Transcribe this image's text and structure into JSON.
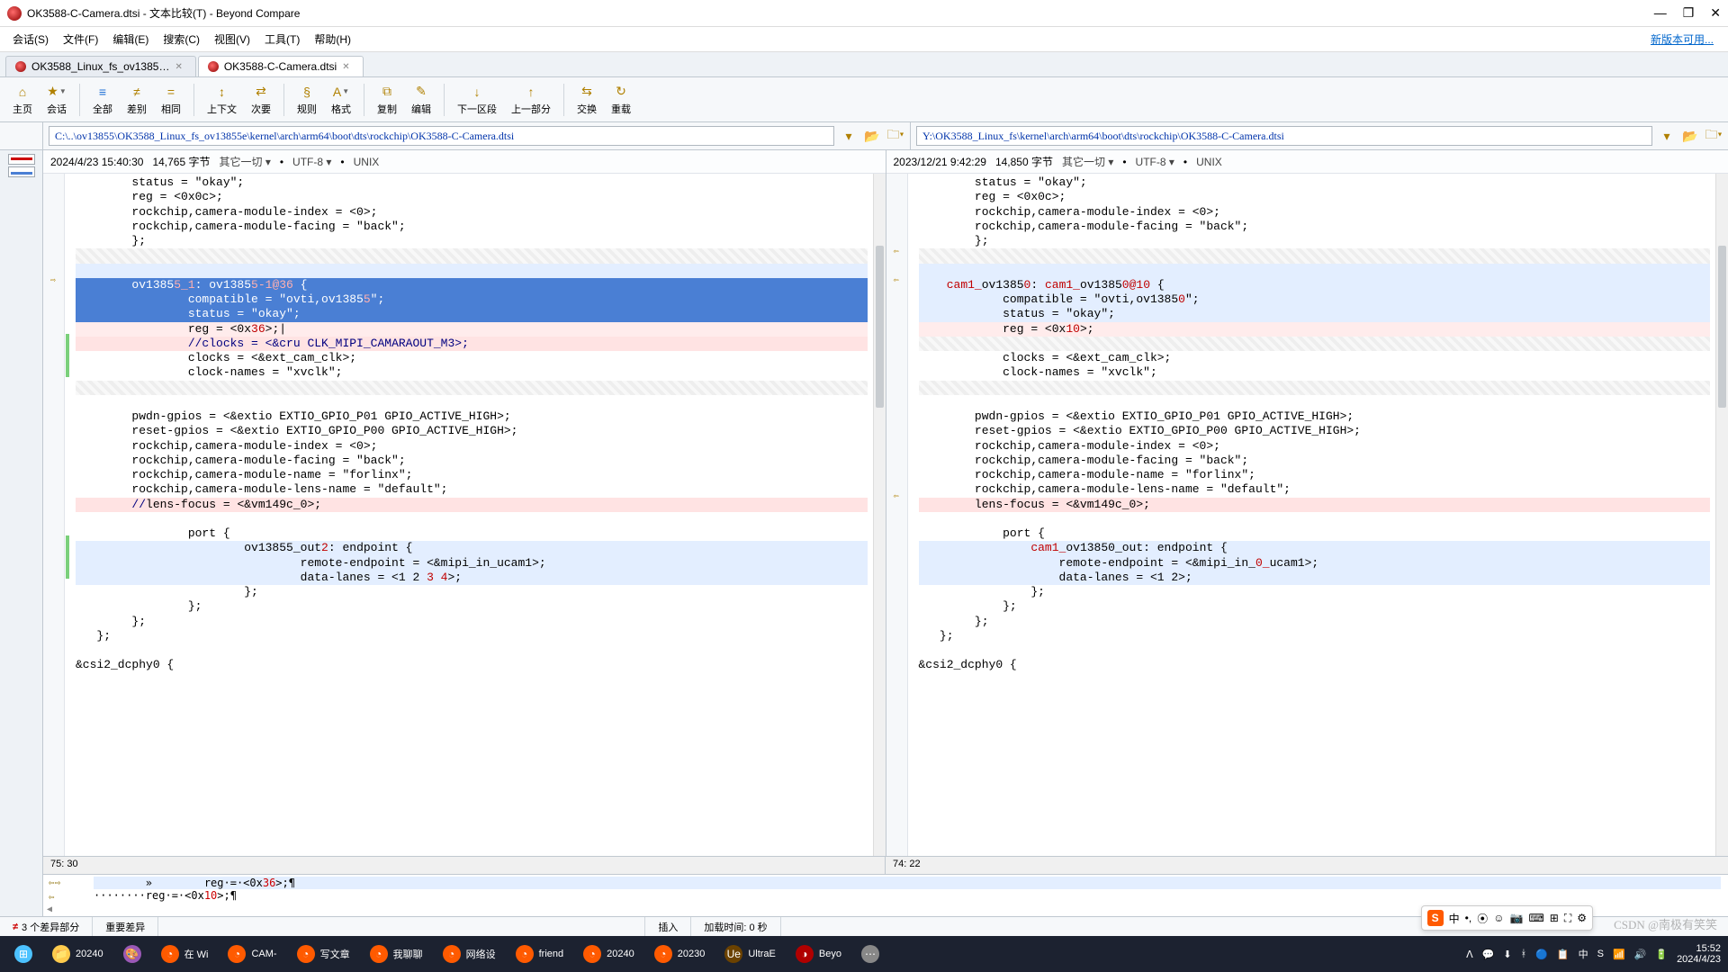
{
  "window": {
    "title": "OK3588-C-Camera.dtsi - 文本比较(T) - Beyond Compare",
    "min": "—",
    "max": "❐",
    "close": "✕",
    "update_link": "新版本可用..."
  },
  "menu": {
    "items": [
      "会话(S)",
      "文件(F)",
      "编辑(E)",
      "搜索(C)",
      "视图(V)",
      "工具(T)",
      "帮助(H)"
    ]
  },
  "filetabs": [
    {
      "label": "OK3588_Linux_fs_ov1385…"
    },
    {
      "label": "OK3588-C-Camera.dtsi"
    }
  ],
  "toolbar": [
    {
      "icon": "⌂",
      "label": "主页"
    },
    {
      "icon": "★",
      "label": "会话",
      "drop": true,
      "sep": true
    },
    {
      "icon": "≡",
      "label": "全部",
      "blue": true
    },
    {
      "icon": "≠",
      "label": "差别"
    },
    {
      "icon": "=",
      "label": "相同",
      "sep": true
    },
    {
      "icon": "↕",
      "label": "上下文"
    },
    {
      "icon": "⇄",
      "label": "次要",
      "sep": true
    },
    {
      "icon": "§",
      "label": "规则"
    },
    {
      "icon": "A",
      "label": "格式",
      "drop": true,
      "sep": true
    },
    {
      "icon": "⧉",
      "label": "复制"
    },
    {
      "icon": "✎",
      "label": "编辑",
      "sep": true
    },
    {
      "icon": "↓",
      "label": "下一区段"
    },
    {
      "icon": "↑",
      "label": "上一部分",
      "sep": true
    },
    {
      "icon": "⇆",
      "label": "交换"
    },
    {
      "icon": "↻",
      "label": "重载"
    }
  ],
  "paths": {
    "left": "C:\\..\\ov13855\\OK3588_Linux_fs_ov13855e\\kernel\\arch\\arm64\\boot\\dts\\rockchip\\OK3588-C-Camera.dtsi",
    "right": "Y:\\OK3588_Linux_fs\\kernel\\arch\\arm64\\boot\\dts\\rockchip\\OK3588-C-Camera.dtsi"
  },
  "info": {
    "left": {
      "date": "2024/4/23 15:40:30",
      "size": "14,765 字节",
      "mode": "其它一切 ▾",
      "enc": "UTF-8 ▾",
      "eol": "UNIX"
    },
    "right": {
      "date": "2023/12/21 9:42:29",
      "size": "14,850 字节",
      "mode": "其它一切 ▾",
      "enc": "UTF-8 ▾",
      "eol": "UNIX"
    }
  },
  "cursor": {
    "left": "75: 30",
    "right": "74: 22"
  },
  "diffbar": {
    "a_prefix": "        »        reg·=·<0x",
    "a_val": "36",
    "a_suffix": ">;¶",
    "b_prefix": "········reg·=·<0x",
    "b_val": "10",
    "b_suffix": ">;¶"
  },
  "status": {
    "diffs": "3 个差异部分",
    "mode": "重要差异",
    "ins": "插入",
    "load": "加载时间: 0 秒"
  },
  "left_lines": [
    {
      "cls": "same",
      "t": "        status = \"okay\";"
    },
    {
      "cls": "same",
      "t": "        reg = <0x0c>;"
    },
    {
      "cls": "same",
      "t": "        rockchip,camera-module-index = <0>;"
    },
    {
      "cls": "same",
      "t": "        rockchip,camera-module-facing = \"back\";"
    },
    {
      "cls": "same",
      "t": "        };"
    },
    {
      "cls": "hatch",
      "t": " "
    },
    {
      "cls": "diffblue",
      "t": " "
    },
    {
      "cls": "sel",
      "html": "        ov1385<span class='red' style='color:#ffb0b0'>5_1</span>: ov1385<span style='color:#ffb0b0'>5-1@36</span> {",
      "mark": "⇨"
    },
    {
      "cls": "sel",
      "html": "                compatible = \"ovti,ov1385<span style='color:#ffb0b0'>5</span>\";"
    },
    {
      "cls": "sel",
      "t": "                status = \"okay\";"
    },
    {
      "cls": "diffltred",
      "html": "                reg = &lt;0x<span class='red'>36</span>&gt;;|"
    },
    {
      "cls": "diffred",
      "html": "                <span class='nav'>//clocks = &lt;&amp;cru CLK_MIPI_CAMARAOUT_M3&gt;;</span>",
      "strip": true
    },
    {
      "cls": "same",
      "t": "                clocks = <&ext_cam_clk>;",
      "strip": true
    },
    {
      "cls": "same",
      "t": "                clock-names = \"xvclk\";",
      "strip": true
    },
    {
      "cls": "hatch",
      "t": " "
    },
    {
      "cls": "same",
      "t": " "
    },
    {
      "cls": "same",
      "t": "        pwdn-gpios = <&extio EXTIO_GPIO_P01 GPIO_ACTIVE_HIGH>;"
    },
    {
      "cls": "same",
      "t": "        reset-gpios = <&extio EXTIO_GPIO_P00 GPIO_ACTIVE_HIGH>;"
    },
    {
      "cls": "same",
      "t": "        rockchip,camera-module-index = <0>;"
    },
    {
      "cls": "same",
      "t": "        rockchip,camera-module-facing = \"back\";"
    },
    {
      "cls": "same",
      "t": "        rockchip,camera-module-name = \"forlinx\";"
    },
    {
      "cls": "same",
      "t": "        rockchip,camera-module-lens-name = \"default\";"
    },
    {
      "cls": "diffred",
      "html": "        <span class='nav'>//</span>lens-focus = &lt;&amp;vm149c_0&gt;;"
    },
    {
      "cls": "same",
      "t": " "
    },
    {
      "cls": "same",
      "t": "                port {"
    },
    {
      "cls": "diffblue",
      "html": "                        ov13855_out<span class='red'>2</span>: endpoint {",
      "strip": true
    },
    {
      "cls": "diffblue",
      "html": "                                remote-endpoint = &lt;&amp;mipi_in_ucam1&gt;;",
      "strip": true
    },
    {
      "cls": "diffblue",
      "html": "                                data-lanes = &lt;1 2 <span class='red'>3 4</span>&gt;;",
      "strip": true
    },
    {
      "cls": "same",
      "t": "                        };"
    },
    {
      "cls": "same",
      "t": "                };"
    },
    {
      "cls": "same",
      "t": "        };"
    },
    {
      "cls": "same",
      "t": "   };"
    },
    {
      "cls": "same",
      "t": " "
    },
    {
      "cls": "same",
      "t": "&csi2_dcphy0 {"
    }
  ],
  "right_lines": [
    {
      "cls": "same",
      "t": "        status = \"okay\";"
    },
    {
      "cls": "same",
      "t": "        reg = <0x0c>;"
    },
    {
      "cls": "same",
      "t": "        rockchip,camera-module-index = <0>;"
    },
    {
      "cls": "same",
      "t": "        rockchip,camera-module-facing = \"back\";"
    },
    {
      "cls": "same",
      "t": "        };"
    },
    {
      "cls": "hatch",
      "t": " ",
      "mark": "⇦"
    },
    {
      "cls": "diffblue",
      "t": " "
    },
    {
      "cls": "diffblue",
      "html": "    <span class='red'>cam1_</span>ov1385<span class='red'>0</span>: <span class='red'>cam1_</span>ov1385<span class='red'>0@10</span> {",
      "mark": "⇦"
    },
    {
      "cls": "diffblue",
      "html": "            compatible = \"ovti,ov1385<span class='red'>0</span>\";"
    },
    {
      "cls": "diffblue",
      "t": "            status = \"okay\";"
    },
    {
      "cls": "diffltred",
      "html": "            reg = &lt;0x<span class='red'>10</span>&gt;;"
    },
    {
      "cls": "hatch",
      "t": " "
    },
    {
      "cls": "same",
      "t": "            clocks = <&ext_cam_clk>;"
    },
    {
      "cls": "same",
      "t": "            clock-names = \"xvclk\";"
    },
    {
      "cls": "hatch",
      "t": " "
    },
    {
      "cls": "same",
      "t": " "
    },
    {
      "cls": "same",
      "t": "        pwdn-gpios = <&extio EXTIO_GPIO_P01 GPIO_ACTIVE_HIGH>;"
    },
    {
      "cls": "same",
      "t": "        reset-gpios = <&extio EXTIO_GPIO_P00 GPIO_ACTIVE_HIGH>;"
    },
    {
      "cls": "same",
      "t": "        rockchip,camera-module-index = <0>;"
    },
    {
      "cls": "same",
      "t": "        rockchip,camera-module-facing = \"back\";"
    },
    {
      "cls": "same",
      "t": "        rockchip,camera-module-name = \"forlinx\";"
    },
    {
      "cls": "same",
      "t": "        rockchip,camera-module-lens-name = \"default\";"
    },
    {
      "cls": "diffred",
      "t": "        lens-focus = <&vm149c_0>;",
      "mark": "⇦"
    },
    {
      "cls": "same",
      "t": " "
    },
    {
      "cls": "same",
      "t": "            port {"
    },
    {
      "cls": "diffblue",
      "html": "                <span class='red'>cam1_</span>ov13850_out: endpoint {"
    },
    {
      "cls": "diffblue",
      "html": "                    remote-endpoint = &lt;&amp;mipi_in_<span class='red'>0_</span>ucam1&gt;;"
    },
    {
      "cls": "diffblue",
      "t": "                    data-lanes = <1 2>;"
    },
    {
      "cls": "same",
      "t": "                };"
    },
    {
      "cls": "same",
      "t": "            };"
    },
    {
      "cls": "same",
      "t": "        };"
    },
    {
      "cls": "same",
      "t": "   };"
    },
    {
      "cls": "same",
      "t": " "
    },
    {
      "cls": "same",
      "t": "&csi2_dcphy0 {"
    }
  ],
  "taskbar": {
    "items": [
      {
        "icon": "⊞",
        "color": "#4cc2ff",
        "label": ""
      },
      {
        "icon": "📁",
        "color": "#ffcc4d",
        "label": "20240"
      },
      {
        "icon": "🎨",
        "color": "#9b59b6",
        "label": ""
      },
      {
        "icon": "◔",
        "color": "#ff5a00",
        "label": "在 Wi"
      },
      {
        "icon": "◔",
        "color": "#ff5a00",
        "label": "CAM-"
      },
      {
        "icon": "◔",
        "color": "#ff5a00",
        "label": "写文章"
      },
      {
        "icon": "◔",
        "color": "#ff5a00",
        "label": "我聊聊"
      },
      {
        "icon": "◔",
        "color": "#ff5a00",
        "label": "网络设"
      },
      {
        "icon": "◔",
        "color": "#ff5a00",
        "label": "friend"
      },
      {
        "icon": "◔",
        "color": "#ff5a00",
        "label": "20240"
      },
      {
        "icon": "◔",
        "color": "#ff5a00",
        "label": "20230"
      },
      {
        "icon": "Ue",
        "color": "#6b4200",
        "label": "UltraE"
      },
      {
        "icon": "◑",
        "color": "#b00000",
        "label": "Beyo"
      },
      {
        "icon": "⋯",
        "color": "#888",
        "label": ""
      }
    ],
    "tray": [
      "ᐱ",
      "💬",
      "⬇",
      "ᚼ",
      "🔵",
      "📋",
      "中",
      "S",
      "📶",
      "🔊",
      "🔋"
    ],
    "time": "15:52",
    "date": "2024/4/23"
  },
  "sogou": {
    "items": [
      "中",
      "•,",
      "⦿",
      "☺",
      "📷",
      "⌨",
      "⊞",
      "⛶",
      "⚙"
    ]
  },
  "watermark": "CSDN @南极有笑笑"
}
